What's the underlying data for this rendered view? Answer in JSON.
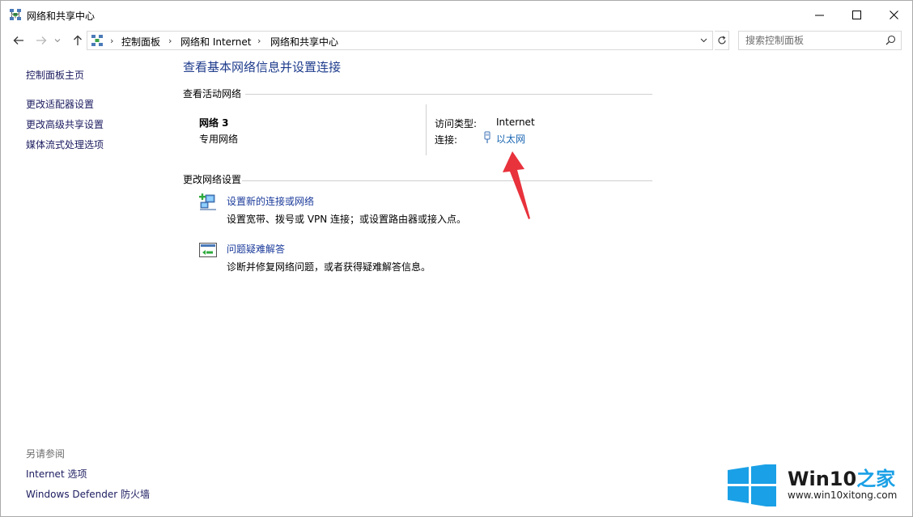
{
  "window": {
    "title": "网络和共享中心"
  },
  "address_bar": {
    "crumbs": [
      "控制面板",
      "网络和 Internet",
      "网络和共享中心"
    ],
    "search_placeholder": "搜索控制面板"
  },
  "left_pane": {
    "home": "控制面板主页",
    "links": [
      "更改适配器设置",
      "更改高级共享设置",
      "媒体流式处理选项"
    ],
    "see_also_header": "另请参阅",
    "see_also": [
      "Internet 选项",
      "Windows Defender 防火墙"
    ]
  },
  "main": {
    "title": "查看基本网络信息并设置连接",
    "active_header": "查看活动网络",
    "network": {
      "name": "网络 3",
      "type": "专用网络",
      "access_label": "访问类型:",
      "access_value": "Internet",
      "conn_label": "连接:",
      "conn_value": "以太网"
    },
    "change_header": "更改网络设置",
    "tasks": [
      {
        "link": "设置新的连接或网络",
        "desc": "设置宽带、拨号或 VPN 连接；或设置路由器或接入点。"
      },
      {
        "link": "问题疑难解答",
        "desc": "诊断并修复网络问题，或者获得疑难解答信息。"
      }
    ]
  },
  "watermark": {
    "title_main": "Win10",
    "title_accent": "之家",
    "url": "www.win10xitong.com"
  },
  "colors": {
    "link": "#1a3a7a",
    "title_blue": "#1e3c8c",
    "arrow_red": "#e8323c",
    "win_blue": "#1aa0e6"
  }
}
